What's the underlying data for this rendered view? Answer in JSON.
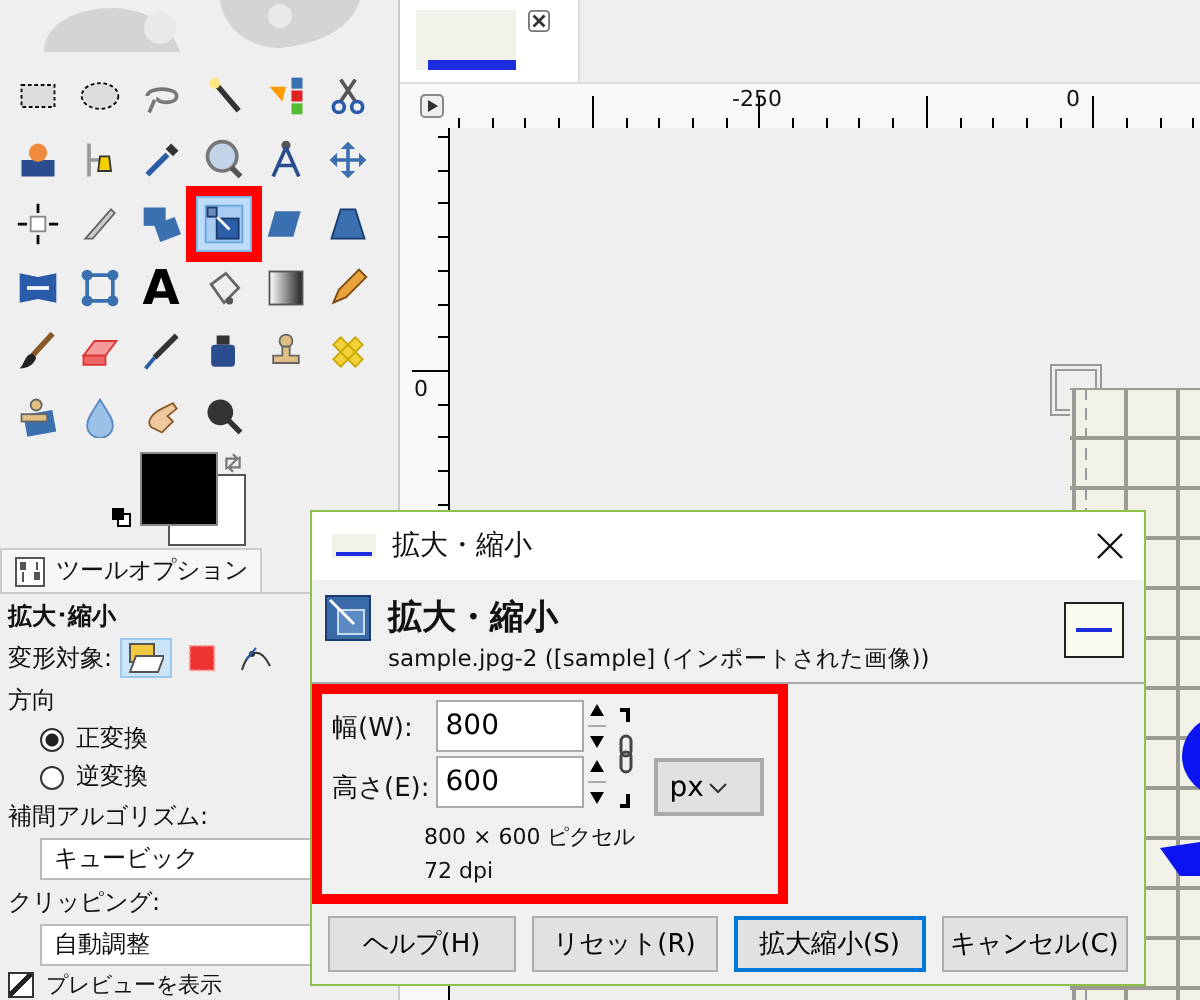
{
  "toolbox": {
    "tools": [
      {
        "selected": false
      },
      {
        "selected": false
      },
      {
        "selected": false
      },
      {
        "selected": false
      },
      {
        "selected": false
      },
      {
        "selected": false
      },
      {
        "selected": false
      },
      {
        "selected": false
      },
      {
        "selected": false
      },
      {
        "selected": false
      },
      {
        "selected": false
      },
      {
        "selected": false
      },
      {
        "selected": false
      },
      {
        "selected": false
      },
      {
        "selected": false
      },
      {
        "selected": true
      },
      {
        "selected": false
      },
      {
        "selected": false
      },
      {
        "selected": false
      },
      {
        "selected": false
      },
      {
        "selected": false,
        "glyph": "A"
      },
      {
        "selected": false
      },
      {
        "selected": false
      },
      {
        "selected": false
      },
      {
        "selected": false
      },
      {
        "selected": false
      },
      {
        "selected": false
      },
      {
        "selected": false
      },
      {
        "selected": false
      },
      {
        "selected": false
      },
      {
        "selected": false
      },
      {
        "selected": false
      },
      {
        "selected": false
      },
      {
        "selected": false
      }
    ]
  },
  "tool_options": {
    "tab": "ツールオプション",
    "tool_name": "拡大･縮小",
    "transform_label": "変形対象:",
    "transform_targets": [
      {
        "selected": true
      },
      {
        "selected": false
      },
      {
        "selected": false
      }
    ],
    "direction_label": "方向",
    "directions": [
      {
        "label": "正変換",
        "selected": true
      },
      {
        "label": "逆変換",
        "selected": false
      }
    ],
    "interpolation_label": "補間アルゴリズム:",
    "interpolation": "キュービック",
    "clipping_label": "クリッピング:",
    "clipping": "自動調整",
    "preview": {
      "label": "プレビューを表示",
      "checked": true
    }
  },
  "rulers": {
    "top_labels": [
      "-250",
      "0"
    ],
    "left_labels": [
      "0"
    ]
  },
  "dialog": {
    "title": "拡大・縮小",
    "heading": "拡大・縮小",
    "subtitle": "sample.jpg-2 ([sample] (インポートされた画像))",
    "fields": [
      {
        "label": "幅(W):",
        "value": "800"
      },
      {
        "label": "高さ(E):",
        "value": "600"
      }
    ],
    "unit": "px",
    "size_info": "800 × 600 ピクセル",
    "resolution": "72 dpi",
    "buttons": [
      {
        "label": "ヘルプ(H)",
        "default": false
      },
      {
        "label": "リセット(R)",
        "default": false
      },
      {
        "label": "拡大縮小(S)",
        "default": true
      },
      {
        "label": "キャンセル(C)",
        "default": false
      }
    ]
  }
}
